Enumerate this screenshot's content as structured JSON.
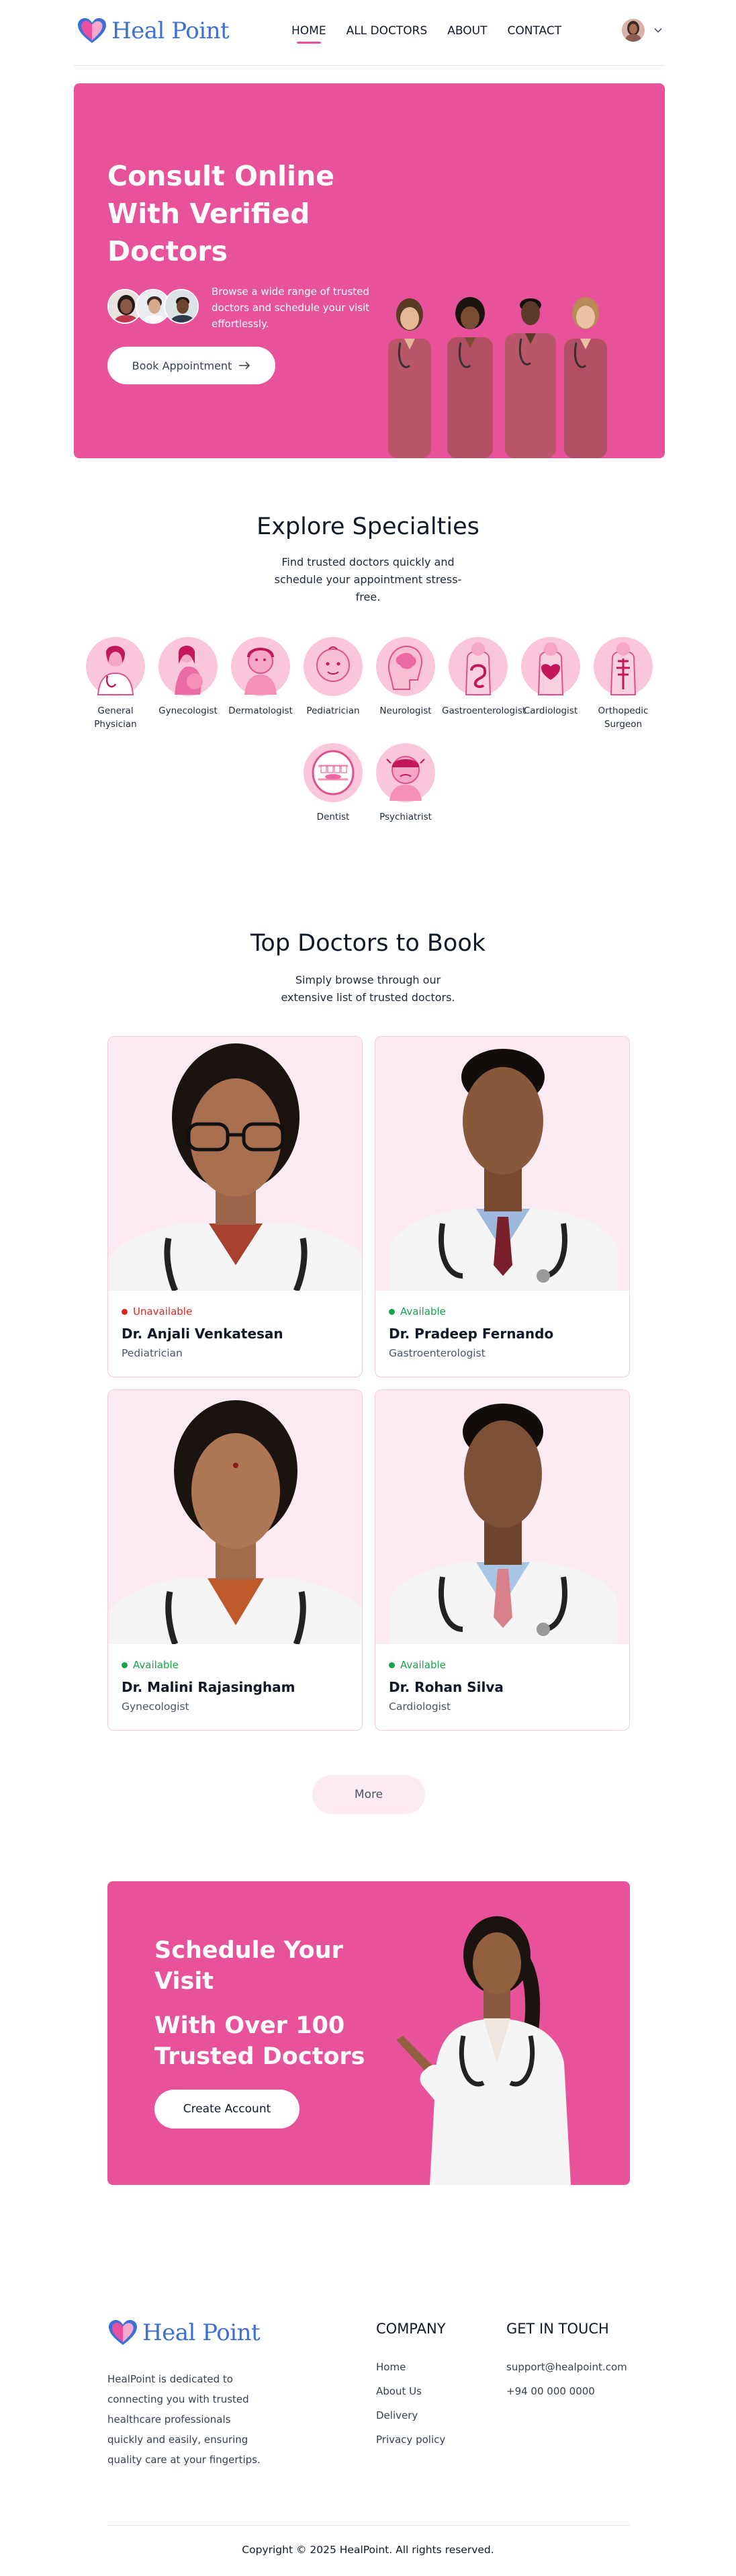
{
  "brand": {
    "name": "Heal Point",
    "primary": "#e8529b",
    "logo_blue": "#3b6fd6",
    "available": "#16a34a",
    "unavailable": "#dc2626"
  },
  "nav": {
    "links": [
      {
        "label": "HOME",
        "active": true
      },
      {
        "label": "ALL DOCTORS",
        "active": false
      },
      {
        "label": "ABOUT",
        "active": false
      },
      {
        "label": "CONTACT",
        "active": false
      }
    ],
    "avatar_icon": "user-avatar",
    "menu_icon": "chevron-down-icon"
  },
  "hero": {
    "title": "Consult Online With Verified Doctors",
    "subtitle": "Browse a wide range of trusted doctors and schedule your visit effortlessly.",
    "button_label": "Book Appointment",
    "button_icon": "arrow-right-icon"
  },
  "specialties": {
    "title": "Explore Specialties",
    "subtitle": "Find trusted doctors quickly and schedule your appointment stress-free.",
    "items": [
      {
        "label": "General Physician",
        "icon": "general-physician-icon"
      },
      {
        "label": "Gynecologist",
        "icon": "gynecologist-icon"
      },
      {
        "label": "Dermatologist",
        "icon": "dermatologist-icon"
      },
      {
        "label": "Pediatrician",
        "icon": "pediatrician-icon"
      },
      {
        "label": "Neurologist",
        "icon": "neurologist-icon"
      },
      {
        "label": "Gastroenterologist",
        "icon": "gastroenterologist-icon"
      },
      {
        "label": "Cardiologist",
        "icon": "cardiologist-icon"
      },
      {
        "label": "Orthopedic Surgeon",
        "icon": "orthopedic-icon"
      },
      {
        "label": "Dentist",
        "icon": "dentist-icon"
      },
      {
        "label": "Psychiatrist",
        "icon": "psychiatrist-icon"
      }
    ]
  },
  "doctors": {
    "title": "Top Doctors to Book",
    "subtitle": "Simply browse through our extensive list of trusted doctors.",
    "items": [
      {
        "status": "Unavailable",
        "name": "Dr. Anjali Venkatesan",
        "specialty": "Pediatrician"
      },
      {
        "status": "Available",
        "name": "Dr. Pradeep Fernando",
        "specialty": "Gastroenterologist"
      },
      {
        "status": "Available",
        "name": "Dr. Malini Rajasingham",
        "specialty": "Gynecologist"
      },
      {
        "status": "Available",
        "name": "Dr. Rohan Silva",
        "specialty": "Cardiologist"
      }
    ],
    "more_label": "More"
  },
  "cta": {
    "line1": "Schedule Your Visit",
    "line2": "With Over 100 Trusted Doctors",
    "button_label": "Create Account"
  },
  "footer": {
    "description": "HealPoint is dedicated to connecting you with trusted healthcare professionals quickly and easily, ensuring quality care at your fingertips.",
    "company_title": "COMPANY",
    "company_links": [
      "Home",
      "About Us",
      "Delivery",
      "Privacy policy"
    ],
    "contact_title": "GET IN TOUCH",
    "contact_items": [
      "support@healpoint.com",
      "+94 00 000 0000"
    ],
    "copyright": "Copyright © 2025 HealPoint. All rights reserved."
  }
}
